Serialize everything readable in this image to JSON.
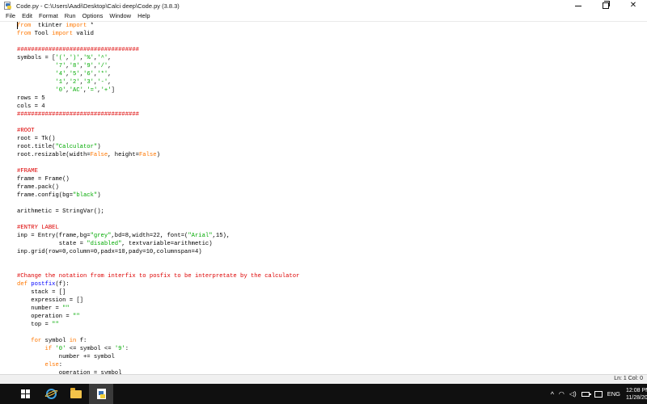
{
  "window": {
    "title": "Code.py - C:\\Users\\Aadi\\Desktop\\Calci deep\\Code.py (3.8.3)"
  },
  "menu": [
    "File",
    "Edit",
    "Format",
    "Run",
    "Options",
    "Window",
    "Help"
  ],
  "code_lines": [
    [
      [
        "kw",
        "from"
      ],
      [
        "",
        "  tkinter "
      ],
      [
        "kw",
        "import"
      ],
      [
        "",
        " *"
      ]
    ],
    [
      [
        "kw",
        "from"
      ],
      [
        "",
        " Tool "
      ],
      [
        "kw",
        "import"
      ],
      [
        "",
        " valid"
      ]
    ],
    [
      [
        "",
        ""
      ]
    ],
    [
      [
        "cm",
        "###################################"
      ]
    ],
    [
      [
        "",
        "symbols = ["
      ],
      [
        "st",
        "'('"
      ],
      [
        "",
        ","
      ],
      [
        "st",
        "')'"
      ],
      [
        "",
        ","
      ],
      [
        "st",
        "'%'"
      ],
      [
        "",
        ","
      ],
      [
        "st",
        "'^'"
      ],
      [
        "",
        ","
      ]
    ],
    [
      [
        "",
        "           "
      ],
      [
        "st",
        "'7'"
      ],
      [
        "",
        ","
      ],
      [
        "st",
        "'8'"
      ],
      [
        "",
        ","
      ],
      [
        "st",
        "'9'"
      ],
      [
        "",
        ","
      ],
      [
        "st",
        "'/'"
      ],
      [
        "",
        ","
      ]
    ],
    [
      [
        "",
        "           "
      ],
      [
        "st",
        "'4'"
      ],
      [
        "",
        ","
      ],
      [
        "st",
        "'5'"
      ],
      [
        "",
        ","
      ],
      [
        "st",
        "'6'"
      ],
      [
        "",
        ","
      ],
      [
        "st",
        "'*'"
      ],
      [
        "",
        ","
      ]
    ],
    [
      [
        "",
        "           "
      ],
      [
        "st",
        "'1'"
      ],
      [
        "",
        ","
      ],
      [
        "st",
        "'2'"
      ],
      [
        "",
        ","
      ],
      [
        "st",
        "'3'"
      ],
      [
        "",
        ","
      ],
      [
        "st",
        "'-'"
      ],
      [
        "",
        ","
      ]
    ],
    [
      [
        "",
        "           "
      ],
      [
        "st",
        "'0'"
      ],
      [
        "",
        ","
      ],
      [
        "st",
        "'AC'"
      ],
      [
        "",
        ","
      ],
      [
        "st",
        "'='"
      ],
      [
        "",
        ","
      ],
      [
        "st",
        "'+'"
      ],
      [
        "",
        "]"
      ]
    ],
    [
      [
        "",
        "rows = 5"
      ]
    ],
    [
      [
        "",
        "cols = 4"
      ]
    ],
    [
      [
        "cm",
        "###################################"
      ]
    ],
    [
      [
        "",
        ""
      ]
    ],
    [
      [
        "cm",
        "#ROOT"
      ]
    ],
    [
      [
        "",
        "root = Tk()"
      ]
    ],
    [
      [
        "",
        "root.title("
      ],
      [
        "st",
        "\"Calculator\""
      ],
      [
        "",
        ")"
      ]
    ],
    [
      [
        "",
        "root.resizable(width="
      ],
      [
        "kw",
        "False"
      ],
      [
        "",
        ", height="
      ],
      [
        "kw",
        "False"
      ],
      [
        "",
        ")"
      ]
    ],
    [
      [
        "",
        ""
      ]
    ],
    [
      [
        "cm",
        "#FRAME"
      ]
    ],
    [
      [
        "",
        "frame = Frame()"
      ]
    ],
    [
      [
        "",
        "frame.pack()"
      ]
    ],
    [
      [
        "",
        "frame.config(bg="
      ],
      [
        "st",
        "\"black\""
      ],
      [
        "",
        ")"
      ]
    ],
    [
      [
        "",
        ""
      ]
    ],
    [
      [
        "",
        "arithmetic = StringVar();"
      ]
    ],
    [
      [
        "",
        ""
      ]
    ],
    [
      [
        "cm",
        "#ENTRY LABEL"
      ]
    ],
    [
      [
        "",
        "inp = Entry(frame,bg="
      ],
      [
        "st",
        "\"grey\""
      ],
      [
        "",
        ",bd=8,width=22, font=("
      ],
      [
        "st",
        "\"Arial\""
      ],
      [
        "",
        ",15),"
      ]
    ],
    [
      [
        "",
        "            state = "
      ],
      [
        "st",
        "\"disabled\""
      ],
      [
        "",
        ", textvariable=arithmetic)"
      ]
    ],
    [
      [
        "",
        "inp.grid(row=0,column=0,padx=10,pady=10,columnspan=4)"
      ]
    ],
    [
      [
        "",
        ""
      ]
    ],
    [
      [
        "",
        ""
      ]
    ],
    [
      [
        "cm",
        "#Change the notation from interfix to posfix to be interpretate by the calculator"
      ]
    ],
    [
      [
        "kw",
        "def"
      ],
      [
        "",
        " "
      ],
      [
        "df",
        "postfix"
      ],
      [
        "",
        "(f):"
      ]
    ],
    [
      [
        "",
        "    stack = []"
      ]
    ],
    [
      [
        "",
        "    expression = []"
      ]
    ],
    [
      [
        "",
        "    number = "
      ],
      [
        "st",
        "\"\""
      ]
    ],
    [
      [
        "",
        "    operation = "
      ],
      [
        "st",
        "\"\""
      ]
    ],
    [
      [
        "",
        "    top = "
      ],
      [
        "st",
        "\"\""
      ]
    ],
    [
      [
        "",
        ""
      ]
    ],
    [
      [
        "",
        "    "
      ],
      [
        "kw",
        "for"
      ],
      [
        "",
        " symbol "
      ],
      [
        "kw",
        "in"
      ],
      [
        "",
        " f:"
      ]
    ],
    [
      [
        "",
        "        "
      ],
      [
        "kw",
        "if"
      ],
      [
        "",
        " "
      ],
      [
        "st",
        "'0'"
      ],
      [
        "",
        " <= symbol <= "
      ],
      [
        "st",
        "'9'"
      ],
      [
        "",
        ":"
      ]
    ],
    [
      [
        "",
        "            number += symbol"
      ]
    ],
    [
      [
        "",
        "        "
      ],
      [
        "kw",
        "else"
      ],
      [
        "",
        ":"
      ]
    ],
    [
      [
        "",
        "            operation = symbol"
      ]
    ]
  ],
  "status": {
    "cursor_pos": "Ln: 1  Col: 0"
  },
  "taskbar": {
    "language": "ENG",
    "time": "12:08 PM",
    "date": "11/28/2020"
  },
  "colors": {
    "keyword": "#ff7700",
    "string": "#00aa00",
    "comment": "#dd0000",
    "definition": "#0000ff",
    "taskbar": "#101010"
  }
}
